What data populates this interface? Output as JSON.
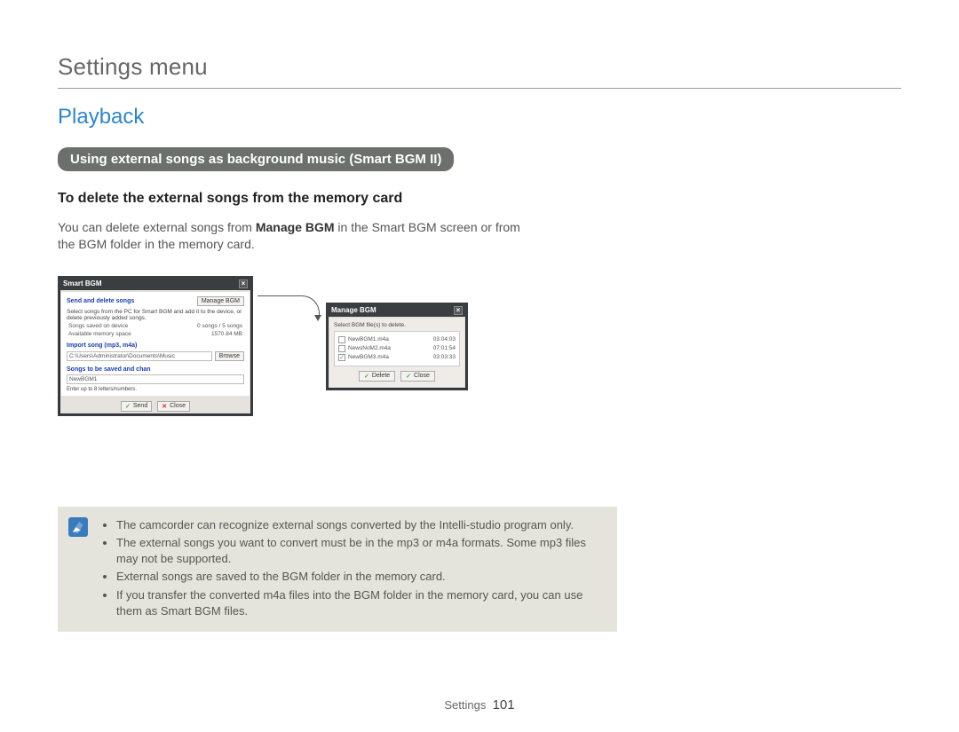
{
  "page_title": "Settings menu",
  "section_title": "Playback",
  "pill_label": "Using external songs as background music (Smart BGM II)",
  "subheading": "To delete the external songs from the memory card",
  "body_pre": "You can delete external songs from ",
  "body_bold": "Manage BGM",
  "body_post": " in the Smart BGM screen or from the BGM folder in the memory card.",
  "win1": {
    "title": "Smart BGM",
    "close": "×",
    "send_delete": "Send and delete songs",
    "manage_btn": "Manage BGM",
    "desc": "Select songs from the PC for Smart BGM and add it to the device, or delete previously added songs.",
    "row1_label": "Songs saved on device",
    "row1_value": "0 songs / 5 songs",
    "row2_label": "Available memory space",
    "row2_value": "1570.84 MB",
    "import_label": "Import song (mp3, m4a)",
    "path": "C:\\Users\\Administrator\\Documents\\Music",
    "browse": "Browse",
    "rename_label": "Songs to be saved and chan",
    "rename_value": "NewBGM1",
    "rename_hint": "Enter up to 8 letters/numbers.",
    "send": "Send",
    "close_btn": "Close"
  },
  "win2": {
    "title": "Manage BGM",
    "close": "×",
    "hint": "Select BGM file(s) to delete.",
    "items": [
      {
        "name": "NewBGM1.m4a",
        "dur": "03:04:03",
        "checked": false
      },
      {
        "name": "NewsNoM2.m4a",
        "dur": "07:01:54",
        "checked": false
      },
      {
        "name": "NewBGM3.m4a",
        "dur": "03:03:33",
        "checked": true
      }
    ],
    "delete": "Delete",
    "close_btn": "Close"
  },
  "notes": [
    "The camcorder can recognize external songs converted by the Intelli-studio program only.",
    "The external songs you want to convert must be in the mp3 or m4a formats. Some mp3 files may not be supported.",
    "External songs are saved to the BGM folder in the memory card.",
    "If you transfer the converted m4a files into the BGM folder in the memory card, you can use them as Smart BGM files."
  ],
  "footer_label": "Settings",
  "footer_page": "101"
}
